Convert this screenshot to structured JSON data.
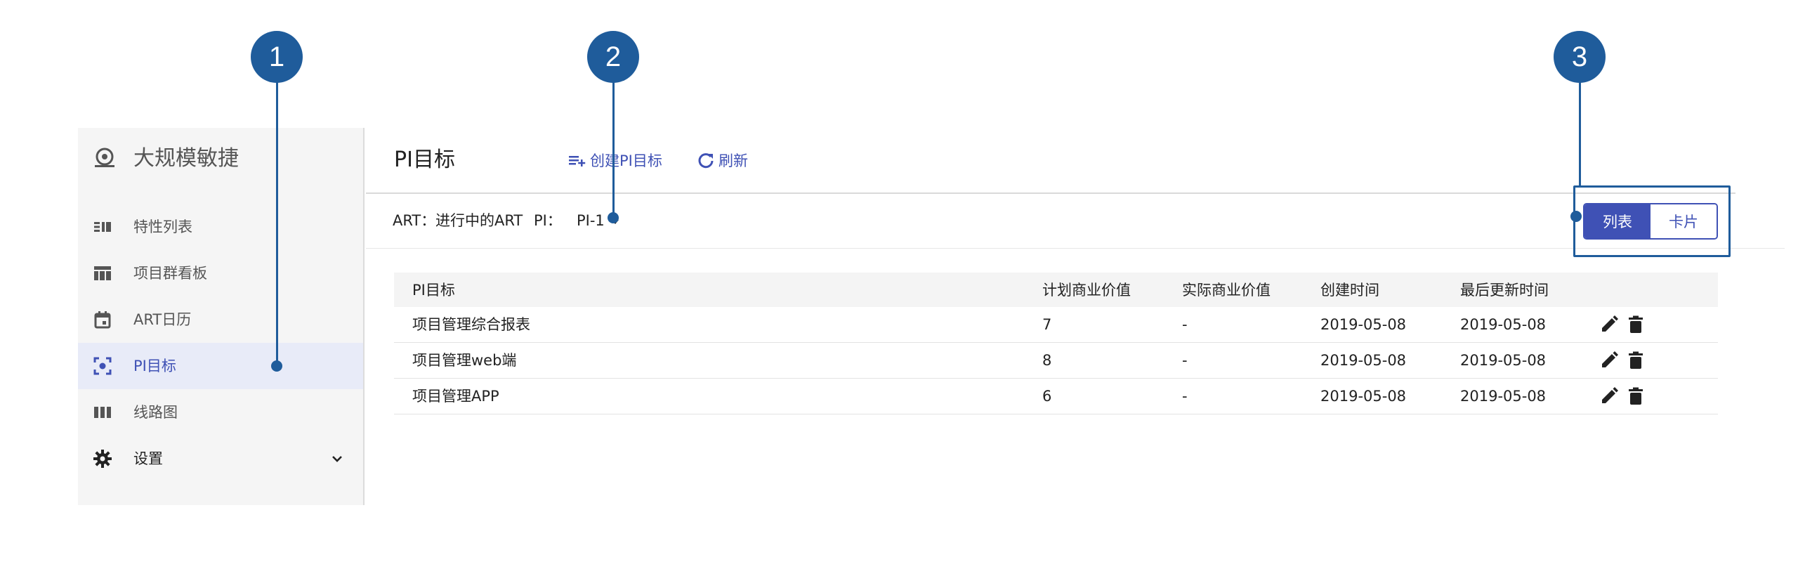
{
  "sidebar": {
    "brand": "大规模敏捷",
    "items": [
      {
        "label": "特性列表",
        "icon": "feature-list-icon"
      },
      {
        "label": "项目群看板",
        "icon": "board-icon"
      },
      {
        "label": "ART日历",
        "icon": "calendar-icon"
      },
      {
        "label": "PI目标",
        "icon": "target-icon",
        "active": true
      },
      {
        "label": "线路图",
        "icon": "roadmap-icon"
      },
      {
        "label": "设置",
        "icon": "gear-icon"
      }
    ]
  },
  "header": {
    "title": "PI目标",
    "create_label": "创建PI目标",
    "refresh_label": "刷新"
  },
  "filter": {
    "art_label": "ART：",
    "art_value": "进行中的ART",
    "pi_label": "PI：",
    "pi_value": "PI-1"
  },
  "view_toggle": {
    "list_label": "列表",
    "card_label": "卡片",
    "selected": "列表"
  },
  "table": {
    "columns": [
      "PI目标",
      "计划商业价值",
      "实际商业价值",
      "创建时间",
      "最后更新时间"
    ],
    "rows": [
      [
        "项目管理综合报表",
        "7",
        "-",
        "2019-05-08",
        "2019-05-08"
      ],
      [
        "项目管理web端",
        "8",
        "-",
        "2019-05-08",
        "2019-05-08"
      ],
      [
        "项目管理APP",
        "6",
        "-",
        "2019-05-08",
        "2019-05-08"
      ]
    ]
  },
  "callouts": [
    "1",
    "2",
    "3"
  ],
  "colors": {
    "accent": "#3f51b5",
    "callout": "#1f5c9b",
    "active_bg": "#e8ebf8"
  }
}
